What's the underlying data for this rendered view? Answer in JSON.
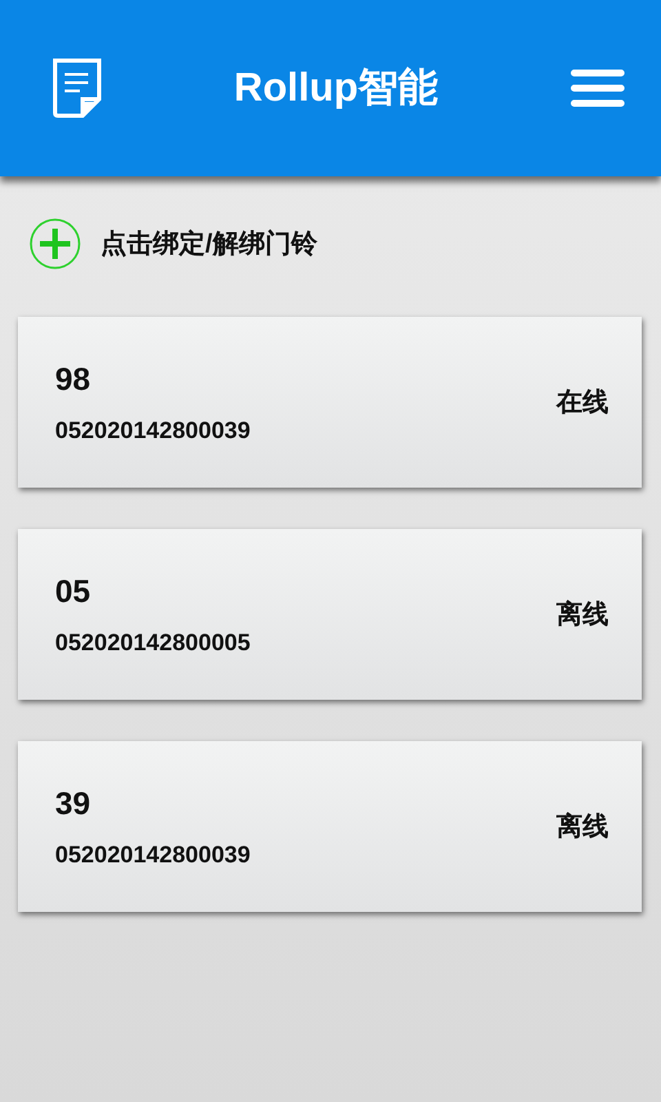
{
  "header": {
    "title": "Rollup智能"
  },
  "bind_action": {
    "label": "点击绑定/解绑门铃"
  },
  "devices": [
    {
      "name": "98",
      "serial": "052020142800039",
      "status": "在线"
    },
    {
      "name": "05",
      "serial": "052020142800005",
      "status": "离线"
    },
    {
      "name": "39",
      "serial": "052020142800039",
      "status": "离线"
    }
  ]
}
